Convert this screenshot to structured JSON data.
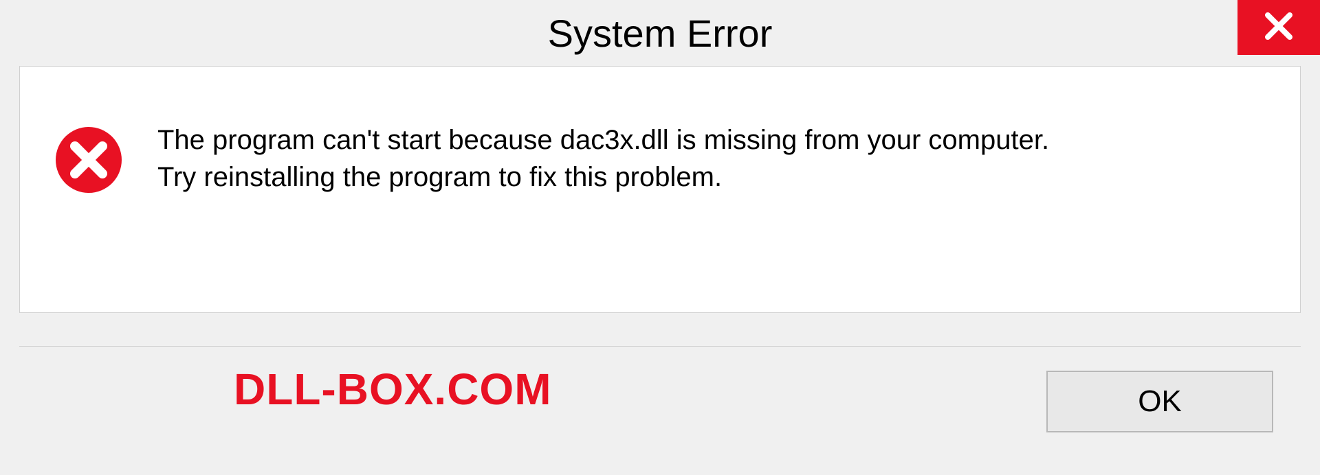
{
  "dialog": {
    "title": "System Error",
    "message_line1": "The program can't start because dac3x.dll is missing from your computer.",
    "message_line2": "Try reinstalling the program to fix this problem.",
    "ok_label": "OK"
  },
  "watermark": {
    "text": "DLL-BOX.COM"
  },
  "colors": {
    "close_red": "#e81123",
    "error_red": "#e81123"
  }
}
